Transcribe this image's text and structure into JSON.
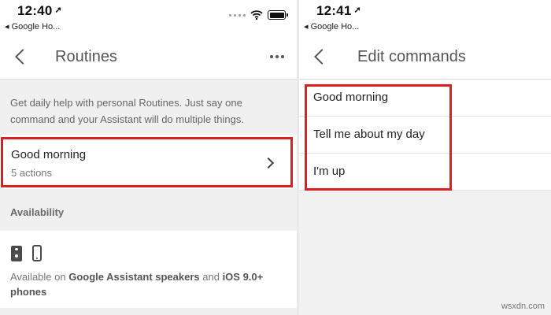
{
  "left": {
    "status": {
      "time": "12:40",
      "back_app": "◂ Google Ho..."
    },
    "title": "Routines",
    "description": "Get daily help with personal Routines. Just say one command and your Assistant will do multiple things.",
    "routine": {
      "title": "Good morning",
      "subtitle": "5 actions"
    },
    "section": "Availability",
    "availability": {
      "prefix": "Available on ",
      "highlight1": "Google Assistant speakers",
      "middle": " and ",
      "highlight2": "iOS 9.0+ phones"
    }
  },
  "right": {
    "status": {
      "time": "12:41",
      "back_app": "◂ Google Ho..."
    },
    "title": "Edit commands",
    "commands": [
      "Good morning",
      "Tell me about my day",
      "I'm up"
    ]
  },
  "icons": {
    "location_arrow": "➚",
    "wifi": "wifi-icon",
    "battery": "battery-icon",
    "back": "back-arrow-icon",
    "more": "more-vertical-icon",
    "chevron": "chevron-right-icon",
    "speaker": "speaker-icon",
    "phone": "phone-icon"
  },
  "colors": {
    "highlight": "#dc1f1f",
    "section_bg": "#f0f0f0"
  },
  "watermark": "wsxdn.com"
}
